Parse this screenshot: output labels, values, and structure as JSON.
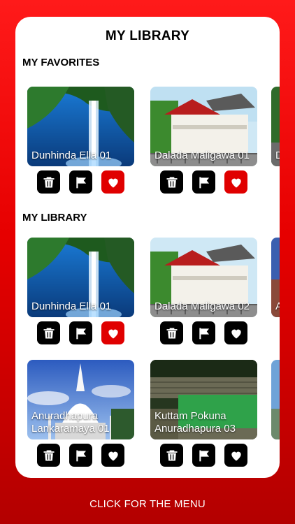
{
  "page_title": "MY LIBRARY",
  "sections": {
    "favorites_title": "MY FAVORITES",
    "library_title": "MY LIBRARY"
  },
  "favorites": [
    {
      "caption": "Dunhinda Ella 01",
      "favorite": true
    },
    {
      "caption": "Dalada Maligawa 01",
      "favorite": true
    },
    {
      "caption": "D",
      "favorite": true
    }
  ],
  "library": [
    {
      "caption": "Dunhinda Ella 01",
      "favorite": true
    },
    {
      "caption": "Dalada Maligawa 02",
      "favorite": false
    },
    {
      "caption": "A L",
      "favorite": false
    },
    {
      "caption": "Anuradhapura Lankaramaya 01",
      "favorite": false
    },
    {
      "caption": "Kuttam Pokuna Anuradhapura 03",
      "favorite": false
    },
    {
      "caption": "",
      "favorite": false
    }
  ],
  "menu_label": "CLICK FOR THE MENU",
  "icons": {
    "delete": "trash-icon",
    "report": "flag-icon",
    "favorite": "heart-icon"
  },
  "colors": {
    "brand_red": "#e60000",
    "favorite_active": "#e00000",
    "button_dark": "#000000"
  }
}
